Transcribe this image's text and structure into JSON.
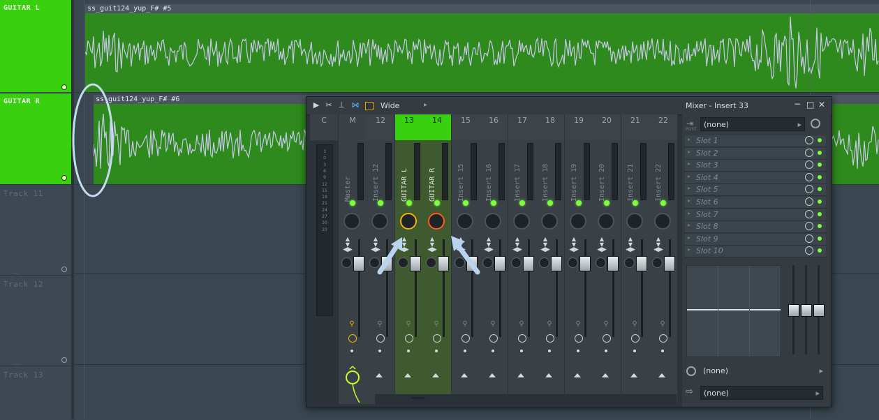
{
  "playlist": {
    "tracks": [
      {
        "name": "GUITAR L",
        "clip": "ss_guit124_yup_F# #5"
      },
      {
        "name": "GUITAR R",
        "clip": "ss_guit124_yup_F# #6"
      },
      {
        "name": "Track 11"
      },
      {
        "name": "Track 12"
      },
      {
        "name": "Track 13"
      }
    ],
    "track_dots": [
      "...",
      "..."
    ],
    "colors": {
      "track_green": "#39d10f",
      "clip_green": "#2f8a1e",
      "wave": "#c9c8ea"
    }
  },
  "mixer": {
    "toolbar": {
      "view_label": "Wide"
    },
    "title": "Mixer - Insert 33",
    "window_controls": {
      "minimize": "−",
      "maximize": "□",
      "close": "✕"
    },
    "meter_scale": [
      "3",
      "0",
      "3",
      "6",
      "9",
      "12",
      "15",
      "18",
      "21",
      "24",
      "27",
      "30",
      "33"
    ],
    "channels": [
      {
        "num": "C",
        "label": "",
        "type": "current"
      },
      {
        "num": "M",
        "label": "Master",
        "type": "master"
      },
      {
        "num": "12",
        "label": "Insert 12"
      },
      {
        "num": "13",
        "label": "GUITAR L",
        "selected": true
      },
      {
        "num": "14",
        "label": "GUITAR R",
        "selected": true
      },
      {
        "num": "15",
        "label": "Insert 15"
      },
      {
        "num": "16",
        "label": "Insert 16"
      },
      {
        "num": "17",
        "label": "Insert 17"
      },
      {
        "num": "18",
        "label": "Insert 18"
      },
      {
        "num": "19",
        "label": "Insert 19"
      },
      {
        "num": "20",
        "label": "Insert 20"
      },
      {
        "num": "21",
        "label": "Insert 21"
      },
      {
        "num": "22",
        "label": "Insert 22"
      }
    ],
    "insert_panel": {
      "input_dropdown": "(none)",
      "slots": [
        "Slot 1",
        "Slot 2",
        "Slot 3",
        "Slot 4",
        "Slot 5",
        "Slot 6",
        "Slot 7",
        "Slot 8",
        "Slot 9",
        "Slot 10"
      ],
      "post_label": "POST",
      "bottom_dropdown_1": "(none)",
      "bottom_dropdown_2": "(none)"
    }
  }
}
